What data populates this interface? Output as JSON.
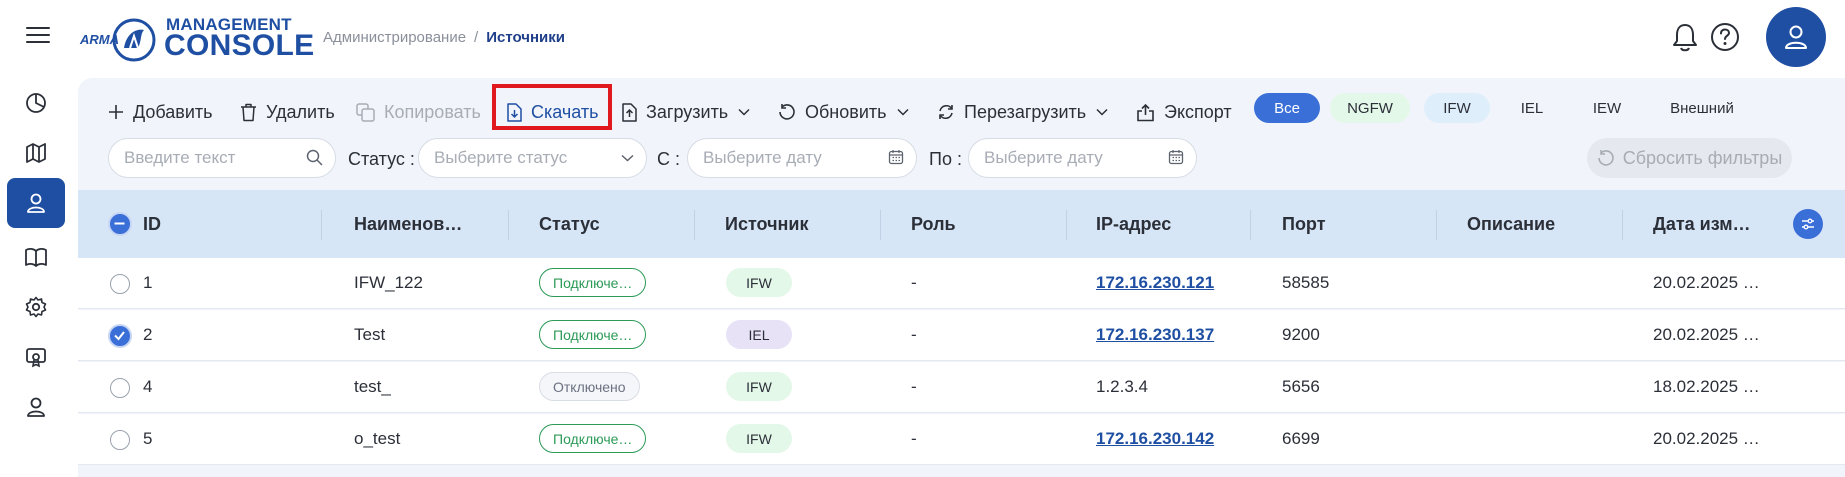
{
  "header": {
    "logo": {
      "brand": "ARMA",
      "line1": "MANAGEMENT",
      "line2": "CONSOLE"
    },
    "breadcrumb": {
      "parent": "Администрирование",
      "separator": "/",
      "current": "Источники"
    }
  },
  "toolbar": {
    "add": "Добавить",
    "delete": "Удалить",
    "copy": "Копировать",
    "download": "Скачать",
    "upload": "Загрузить",
    "refresh": "Обновить",
    "reload": "Перезагрузить",
    "export": "Экспорт"
  },
  "chips": [
    {
      "label": "Все",
      "bg": "#3b6fd8",
      "fg": "#ffffff"
    },
    {
      "label": "NGFW",
      "bg": "#dcf5e6",
      "fg": "#2b2f38"
    },
    {
      "label": "IFW",
      "bg": "#e4f8e9",
      "fg": "#2b2f38"
    },
    {
      "label": "IEL",
      "bg": "#e8e2f7",
      "fg": "#2b2f38"
    },
    {
      "label": "IEW",
      "bg": "#dfeefb",
      "fg": "#2b2f38"
    },
    {
      "label": "Внешний",
      "bg": "#fbecd9",
      "fg": "#2b2f38"
    }
  ],
  "filters": {
    "search_placeholder": "Введите текст",
    "status_label": "Статус :",
    "status_placeholder": "Выберите статус",
    "from_label": "С :",
    "from_placeholder": "Выберите дату",
    "to_label": "По :",
    "to_placeholder": "Выберите дату",
    "reset": "Сбросить фильтры"
  },
  "table": {
    "columns": [
      "ID",
      "Наименов…",
      "Статус",
      "Источник",
      "Роль",
      "IP-адрес",
      "Порт",
      "Описание",
      "Дата изм…"
    ],
    "rows": [
      {
        "checked": false,
        "id": "1",
        "name": "IFW_122",
        "status": "Подключе…",
        "status_kind": "ok",
        "source": "IFW",
        "source_bg": "#e4f8e9",
        "role": "-",
        "ip": "172.16.230.121",
        "ip_link": true,
        "port": "58585",
        "description": "",
        "date": "20.02.2025 …"
      },
      {
        "checked": true,
        "id": "2",
        "name": "Test",
        "status": "Подключе…",
        "status_kind": "ok",
        "source": "IEL",
        "source_bg": "#e8e2f7",
        "role": "-",
        "ip": "172.16.230.137",
        "ip_link": true,
        "port": "9200",
        "description": "",
        "date": "20.02.2025 …"
      },
      {
        "checked": false,
        "id": "4",
        "name": "test_",
        "status": "Отключено",
        "status_kind": "off",
        "source": "IFW",
        "source_bg": "#e4f8e9",
        "role": "-",
        "ip": "1.2.3.4",
        "ip_link": false,
        "port": "5656",
        "description": "",
        "date": "18.02.2025 …"
      },
      {
        "checked": false,
        "id": "5",
        "name": " o_test",
        "status": "Подключе…",
        "status_kind": "ok",
        "source": "IFW",
        "source_bg": "#e4f8e9",
        "role": "-",
        "ip": "172.16.230.142",
        "ip_link": true,
        "port": "6699",
        "description": "",
        "date": "20.02.2025 …"
      }
    ]
  }
}
